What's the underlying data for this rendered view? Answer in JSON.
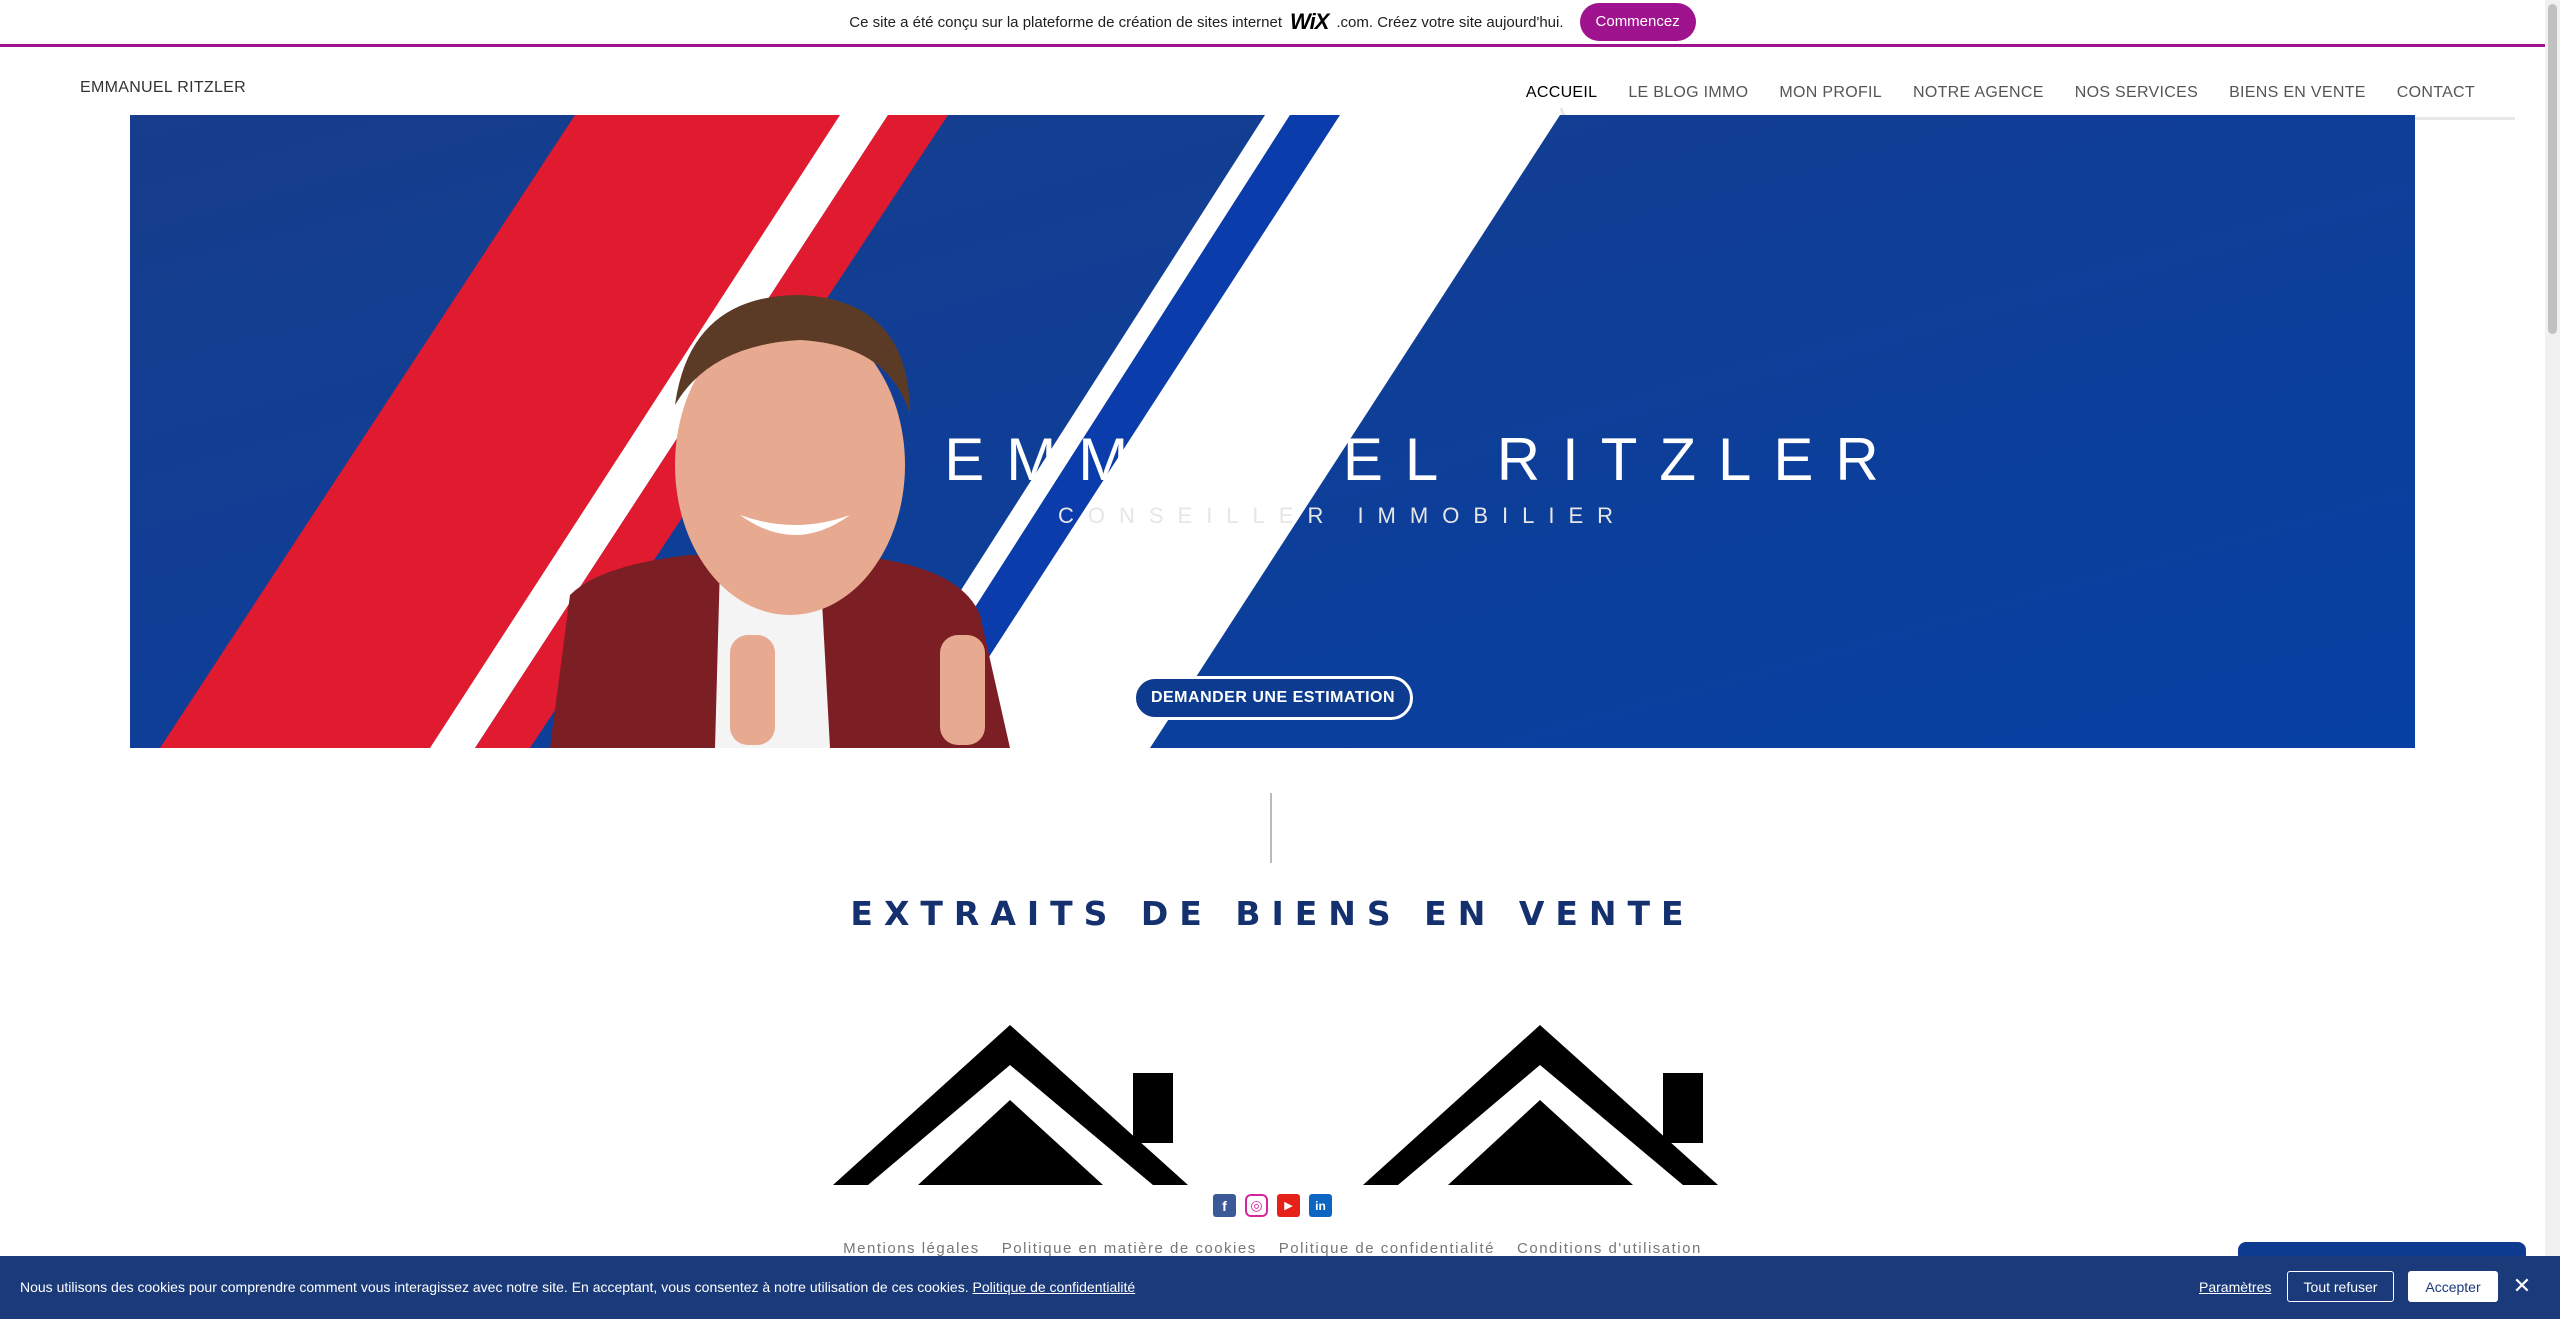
{
  "wix_banner": {
    "text_before": "Ce site a été conçu sur la plateforme de création de sites internet",
    "logo": "WiX",
    "text_after": ".com. Créez votre site aujourd'hui.",
    "cta": "Commencez",
    "accent_color": "#a0138e"
  },
  "header": {
    "brand": "EMMANUEL RITZLER",
    "nav": [
      {
        "label": "ACCUEIL",
        "active": true
      },
      {
        "label": "LE BLOG IMMO",
        "active": false
      },
      {
        "label": "MON PROFIL",
        "active": false
      },
      {
        "label": "NOTRE AGENCE",
        "active": false
      },
      {
        "label": "NOS SERVICES",
        "active": false
      },
      {
        "label": "BIENS EN VENTE",
        "active": false
      },
      {
        "label": "CONTACT",
        "active": false
      }
    ]
  },
  "hero": {
    "title": "EMMANUEL RITZLER",
    "subtitle": "CONSEILLER IMMOBILIER",
    "cta": "DEMANDER UNE ESTIMATION",
    "colors": {
      "blue": "#0c3b9a",
      "red": "#e01b30",
      "white": "#ffffff"
    }
  },
  "section": {
    "title": "EXTRAITS DE BIENS EN VENTE",
    "color": "#14306e"
  },
  "social": [
    {
      "name": "facebook-icon",
      "glyph": "f"
    },
    {
      "name": "instagram-icon",
      "glyph": "◎"
    },
    {
      "name": "youtube-icon",
      "glyph": "▶"
    },
    {
      "name": "linkedin-icon",
      "glyph": "in"
    }
  ],
  "footer": {
    "links": [
      "Mentions légales",
      "Politique en matière de cookies",
      "Politique de confidentialité",
      "Conditions d'utilisation"
    ]
  },
  "cookie_banner": {
    "message": "Nous utilisons des cookies pour comprendre comment vous interagissez avec notre site. En acceptant, vous consentez à notre utilisation de ces cookies.",
    "policy_link": "Politique de confidentialité",
    "settings": "Paramètres",
    "refuse": "Tout refuser",
    "accept": "Accepter",
    "close_glyph": "✕",
    "background": "#1a3a7a"
  }
}
